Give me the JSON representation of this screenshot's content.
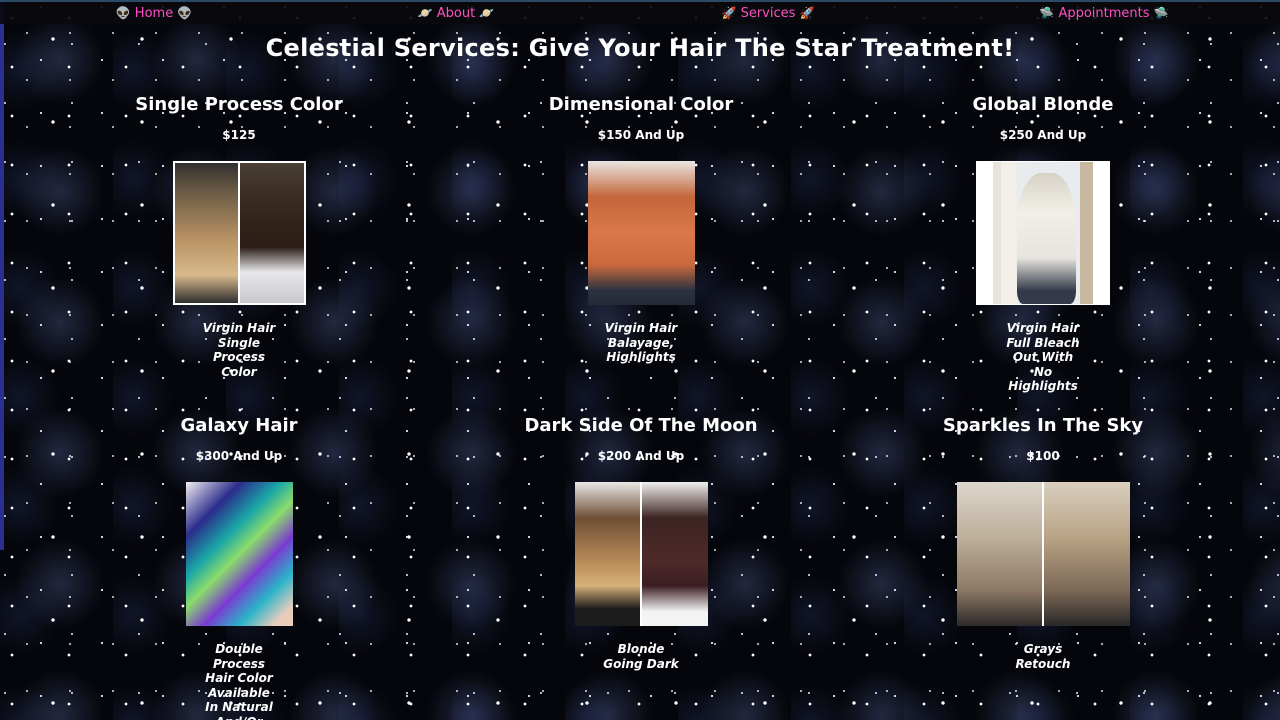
{
  "nav": {
    "items": [
      {
        "icon": "alien-icon",
        "glyph": "👽",
        "label": "Home"
      },
      {
        "icon": "planet-icon",
        "glyph": "🪐",
        "label": "About"
      },
      {
        "icon": "rocket-icon",
        "glyph": "🚀",
        "label": "Services"
      },
      {
        "icon": "ufo-icon",
        "glyph": "🛸",
        "label": "Appointments"
      }
    ],
    "link_color": "#ff4fc4"
  },
  "page": {
    "title": "Celestial Services: Give Your Hair The Star Treatment!"
  },
  "services": [
    {
      "title": "Single Process Color",
      "price": "$125",
      "description": "Virgin Hair\nSingle\nProcess\nColor"
    },
    {
      "title": "Dimensional Color",
      "price": "$150 And Up",
      "description": "Virgin Hair\nBalayage,\nHighlights"
    },
    {
      "title": "Global Blonde",
      "price": "$250 And Up",
      "description": "Virgin Hair\nFull Bleach\nOut With\nNo\nHighlights"
    },
    {
      "title": "Galaxy Hair",
      "price": "$300 And Up",
      "description": "Double\nProcess\nHair Color\nAvailable\nIn Natural\nAnd/Or"
    },
    {
      "title": "Dark Side Of The Moon",
      "price": "$200 And Up",
      "description": "Blonde\nGoing Dark"
    },
    {
      "title": "Sparkles In The Sky",
      "price": "$100",
      "description": "Grays\nRetouch"
    }
  ]
}
